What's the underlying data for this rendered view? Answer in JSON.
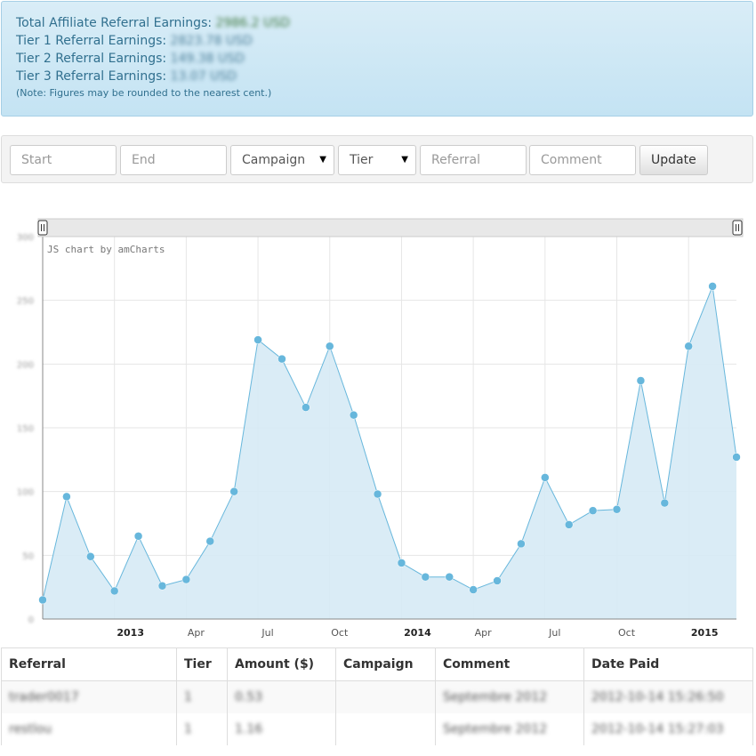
{
  "summary": {
    "total_label": "Total Affiliate Referral Earnings:",
    "total_value": "2986.2 USD",
    "tier1_label": "Tier 1 Referral Earnings:",
    "tier1_value": "2823.78 USD",
    "tier2_label": "Tier 2 Referral Earnings:",
    "tier2_value": "149.38 USD",
    "tier3_label": "Tier 3 Referral Earnings:",
    "tier3_value": "13.07 USD",
    "note": "(Note: Figures may be rounded to the nearest cent.)"
  },
  "filters": {
    "start_placeholder": "Start",
    "end_placeholder": "End",
    "campaign_label": "Campaign",
    "tier_label": "Tier",
    "referral_placeholder": "Referral",
    "comment_placeholder": "Comment",
    "update_label": "Update"
  },
  "chart_data": {
    "type": "area",
    "credit": "JS chart by amCharts",
    "x": [
      "2012-10",
      "2012-11",
      "2012-12",
      "2013-01",
      "2013-02",
      "2013-03",
      "2013-04",
      "2013-05",
      "2013-06",
      "2013-07",
      "2013-08",
      "2013-09",
      "2013-10",
      "2013-11",
      "2013-12",
      "2014-01",
      "2014-02",
      "2014-03",
      "2014-04",
      "2014-05",
      "2014-06",
      "2014-07",
      "2014-08",
      "2014-09",
      "2014-10",
      "2014-11",
      "2014-12",
      "2015-01",
      "2015-02",
      "2015-03"
    ],
    "values": [
      15,
      96,
      49,
      22,
      65,
      26,
      31,
      61,
      100,
      219,
      204,
      166,
      214,
      160,
      98,
      44,
      33,
      33,
      23,
      30,
      59,
      111,
      74,
      85,
      86,
      187,
      91,
      214,
      261,
      127
    ],
    "ylim": [
      0,
      300
    ],
    "ytick_labels": [
      "0",
      "50",
      "100",
      "150",
      "200",
      "250",
      "300"
    ],
    "xtick_labels": [
      "2013",
      "Apr",
      "Jul",
      "Oct",
      "2014",
      "Apr",
      "Jul",
      "Oct",
      "2015"
    ],
    "grid": true,
    "line_color": "#67b7dc",
    "fill_color": "#d6eaf5"
  },
  "table": {
    "headers": [
      "Referral",
      "Tier",
      "Amount ($)",
      "Campaign",
      "Comment",
      "Date Paid"
    ],
    "rows": [
      [
        "trader0017",
        "1",
        "0.53",
        "",
        "Septembre 2012",
        "2012-10-14 15:26:50"
      ],
      [
        "restlou",
        "1",
        "1.16",
        "",
        "Septembre 2012",
        "2012-10-14 15:27:03"
      ]
    ]
  }
}
